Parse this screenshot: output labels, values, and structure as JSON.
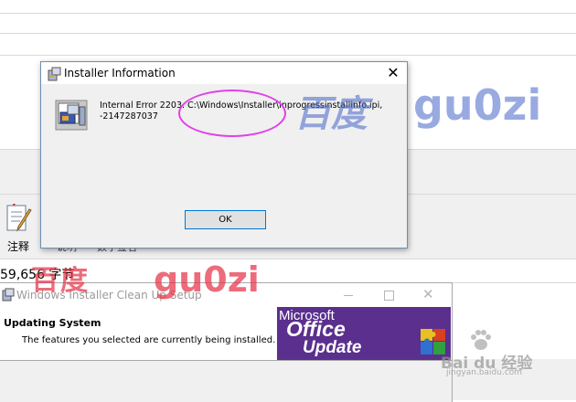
{
  "background": {
    "toolbar_label": "注释",
    "fragment_1": "说明",
    "fragment_2": "数字签名",
    "file_size": "59,656 字节"
  },
  "watermark": {
    "red_cn": "百度",
    "red_en": "gu0zi",
    "blue_cn": "百度",
    "blue_en": "gu0zi",
    "bottom_cn": "Bai du 经验",
    "bottom_url": "jingyan.baidu.com"
  },
  "cleanup": {
    "title": "Windows Installer Clean Up Setup",
    "heading": "Updating System",
    "subtext": "The features you selected are currently being installed.",
    "banner": {
      "line1": "Microsoft",
      "line2": "Office",
      "line3": "Update"
    }
  },
  "dialog": {
    "title": "Installer Information",
    "close_glyph": "✕",
    "message_line1": "Internal Error 2203. C:\\Windows\\Installer\\inprogressinstallinfo.ipi,",
    "message_line2": "-2147287037",
    "ok_label": "OK"
  },
  "colors": {
    "highlight_circle": "#e041e8",
    "office_banner": "#5a2f8e",
    "focus_border": "#0078d7"
  }
}
